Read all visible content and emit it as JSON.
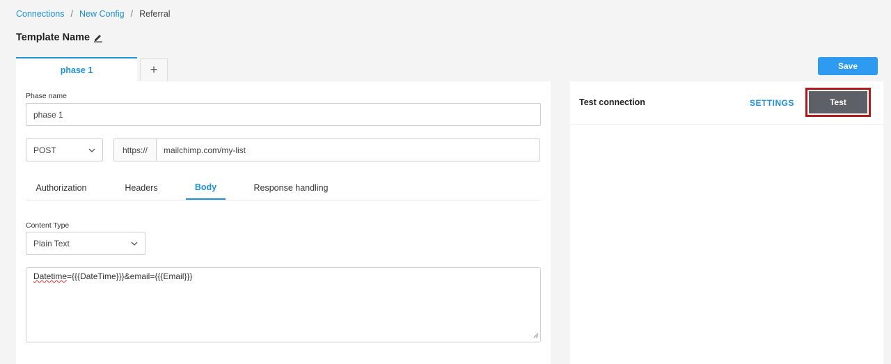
{
  "breadcrumb": {
    "items": [
      "Connections",
      "New Config"
    ],
    "separator": "/",
    "current": "Referral"
  },
  "header": {
    "title": "Template Name",
    "edit_icon": "pencil-icon"
  },
  "tabs": {
    "active_label": "phase 1",
    "add_label": "+"
  },
  "form": {
    "phase_label": "Phase name",
    "phase_value": "phase 1",
    "method_value": "POST",
    "url_prefix": "https://",
    "url_value": "mailchimp.com/my-list",
    "subtabs": [
      "Authorization",
      "Headers",
      "Body",
      "Response handling"
    ],
    "active_subtab": "Body",
    "content_type_label": "Content Type",
    "content_type_value": "Plain Text",
    "body_prefix": "Datetime",
    "body_rest": "={{{DateTime}}}&email={{{Email}}}"
  },
  "toolbar": {
    "save_label": "Save"
  },
  "test_panel": {
    "title": "Test connection",
    "settings_label": "SETTINGS",
    "test_label": "Test"
  },
  "colors": {
    "accent": "#1e90d8",
    "save_button": "#2e9bf0",
    "test_button": "#5d6167",
    "highlight_border": "#b0191e"
  }
}
